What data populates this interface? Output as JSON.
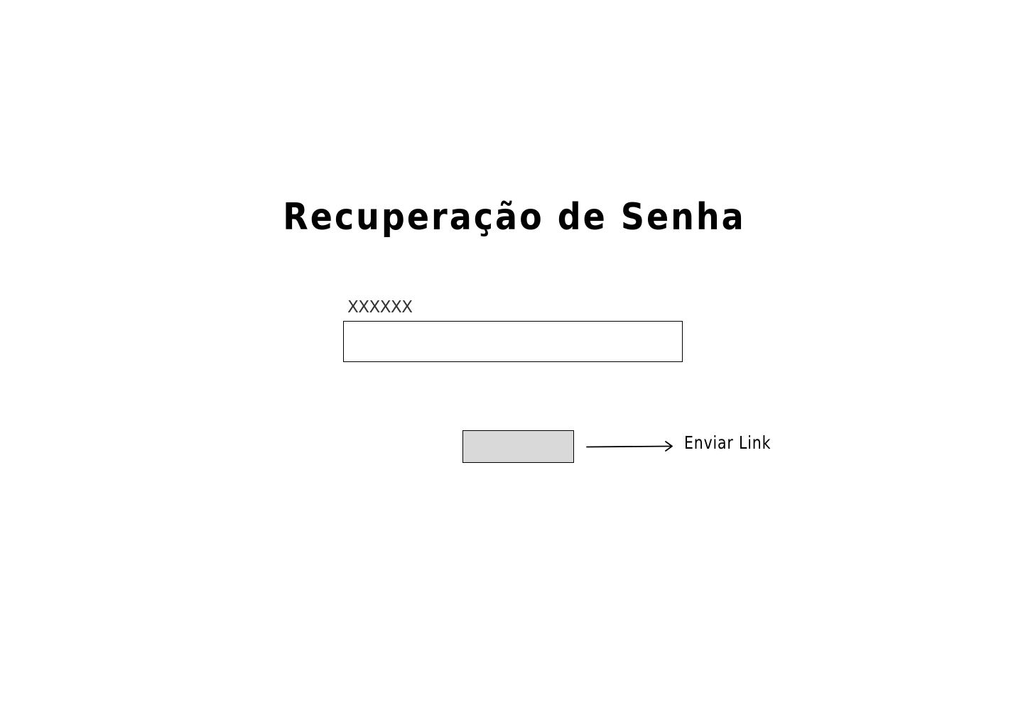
{
  "page": {
    "title": "Recuperação de Senha"
  },
  "form": {
    "field_label": "XXXXXX",
    "field_value": "",
    "send_button_label": ""
  },
  "annotation": {
    "text": "Enviar Link",
    "arrow_icon": "arrow-right-icon"
  },
  "colors": {
    "background": "#ffffff",
    "button_fill": "#d9d9d9",
    "border": "#000000"
  }
}
